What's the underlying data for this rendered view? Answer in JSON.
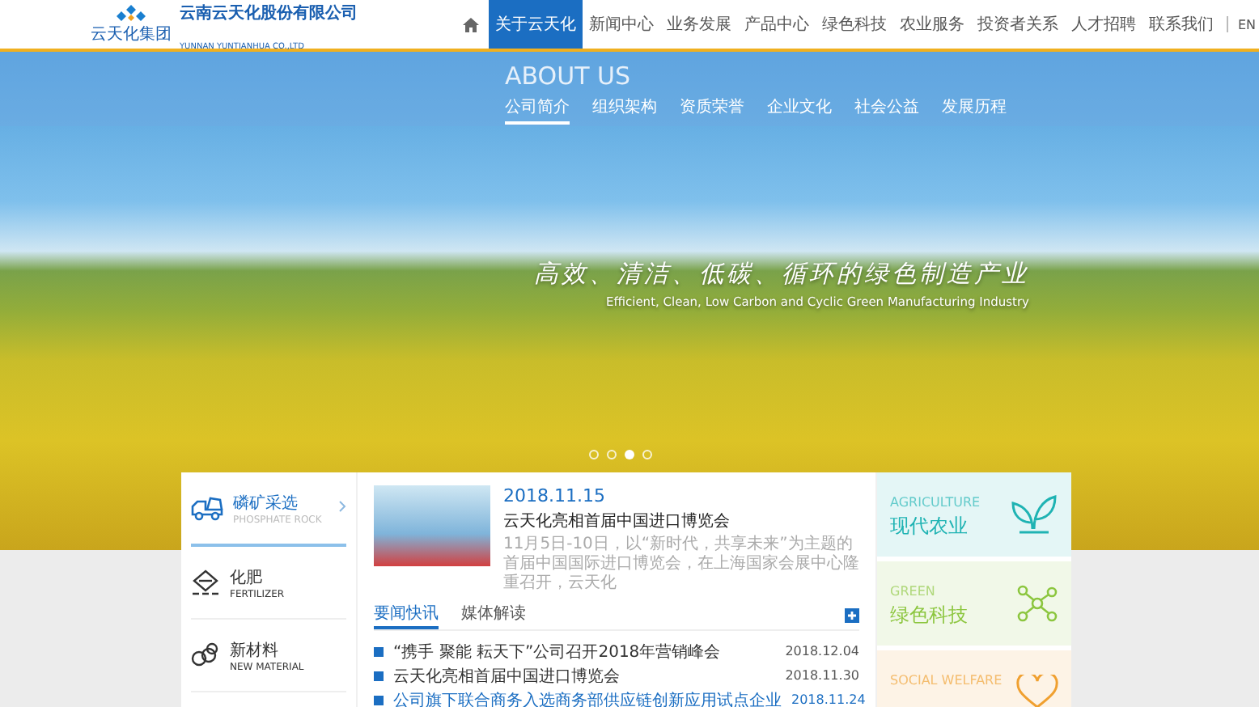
{
  "header": {
    "logo_caption": "云天化集团",
    "company_name": "云南云天化股份有限公司",
    "company_name_en": "YUNNAN YUNTIANHUA CO.,LTD"
  },
  "nav": {
    "items": [
      {
        "label": "关于云天化",
        "selected": true
      },
      {
        "label": "新闻中心",
        "selected": false
      },
      {
        "label": "业务发展",
        "selected": false
      },
      {
        "label": "产品中心",
        "selected": false
      },
      {
        "label": "绿色科技",
        "selected": false
      },
      {
        "label": "农业服务",
        "selected": false
      },
      {
        "label": "投资者关系",
        "selected": false
      },
      {
        "label": "人才招聘",
        "selected": false
      },
      {
        "label": "联系我们",
        "selected": false
      }
    ],
    "language": "EN"
  },
  "hero": {
    "title": "ABOUT US",
    "subnav": [
      {
        "label": "公司简介",
        "selected": true
      },
      {
        "label": "组织架构",
        "selected": false
      },
      {
        "label": "资质荣誉",
        "selected": false
      },
      {
        "label": "企业文化",
        "selected": false
      },
      {
        "label": "社会公益",
        "selected": false
      },
      {
        "label": "发展历程",
        "selected": false
      }
    ],
    "slogan": "高效、清洁、低碳、循环的绿色制造产业",
    "slogan_en": "Efficient, Clean, Low Carbon and Cyclic Green Manufacturing Industry",
    "slides": [
      {
        "selected": false
      },
      {
        "selected": false
      },
      {
        "selected": true
      },
      {
        "selected": false
      }
    ]
  },
  "business": [
    {
      "kind": "mining",
      "title": "磷矿采选",
      "subtitle": "PHOSPHATE ROCK",
      "selected": true
    },
    {
      "kind": "fertilizer",
      "title": "化肥",
      "subtitle": "FERTILIZER",
      "selected": false
    },
    {
      "kind": "material",
      "title": "新材料",
      "subtitle": "NEW MATERIAL",
      "selected": false
    }
  ],
  "featured": {
    "date": "2018.11.15",
    "title": "云天化亮相首届中国进口博览会",
    "summary": "11月5日-10日，以“新时代，共享未来”为主题的首届中国国际进口博览会，在上海国家会展中心隆重召开，云天化"
  },
  "news_tabs": [
    {
      "label": "要闻快讯",
      "selected": true
    },
    {
      "label": "媒体解读",
      "selected": false
    }
  ],
  "news": [
    {
      "title": "“携手 聚能 耘天下”公司召开2018年营销峰会",
      "date": "2018.12.04",
      "highlighted": false
    },
    {
      "title": "云天化亮相首届中国进口博览会",
      "date": "2018.11.30",
      "highlighted": false
    },
    {
      "title": "公司旗下联合商务入选商务部供应链创新应用试点企业",
      "date": "2018.11.24",
      "highlighted": true
    }
  ],
  "features": [
    {
      "kind": "agriculture",
      "label_en": "AGRICULTURE",
      "label": "现代农业",
      "color": "#1fb3b3"
    },
    {
      "kind": "green",
      "label_en": "GREEN",
      "label": "绿色科技",
      "color": "#8cc63f"
    },
    {
      "kind": "welfare",
      "label_en": "SOCIAL WELFARE",
      "color": "#f0a030"
    }
  ]
}
